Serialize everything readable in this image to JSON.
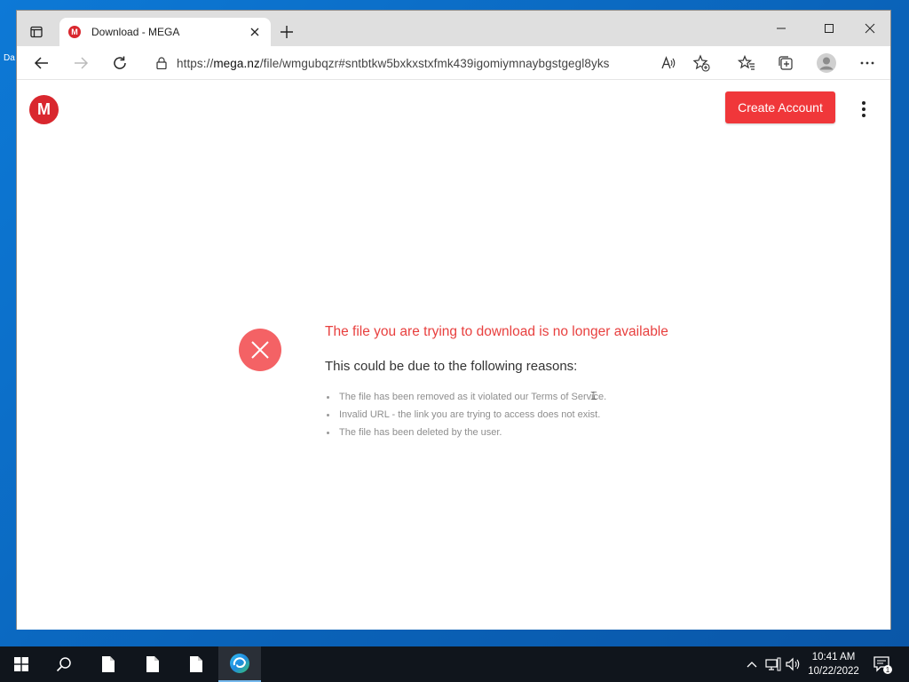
{
  "desktop": {
    "label": "Da"
  },
  "browser": {
    "tab": {
      "title": "Download - MEGA",
      "favicon_letter": "M"
    },
    "address": {
      "scheme": "https://",
      "host": "mega.nz",
      "path": "/file/wmgubqzr#sntbtkw5bxkxstxfmk439igomiymnaybgstgegl8yks"
    }
  },
  "page": {
    "logo_letter": "M",
    "create_account_label": "Create Account",
    "error_title": "The file you are trying to download is no longer available",
    "error_subtitle": "This could be due to the following reasons:",
    "reasons": [
      "The file has been removed as it violated our Terms of Service.",
      "Invalid URL - the link you are trying to access does not exist.",
      "The file has been deleted by the user."
    ]
  },
  "taskbar": {
    "time": "10:41 AM",
    "date": "10/22/2022",
    "notification_count": "1"
  },
  "colors": {
    "mega_red": "#d9272e",
    "button_red": "#f0373a",
    "error_text": "#e8403f",
    "error_icon": "#f46265"
  }
}
